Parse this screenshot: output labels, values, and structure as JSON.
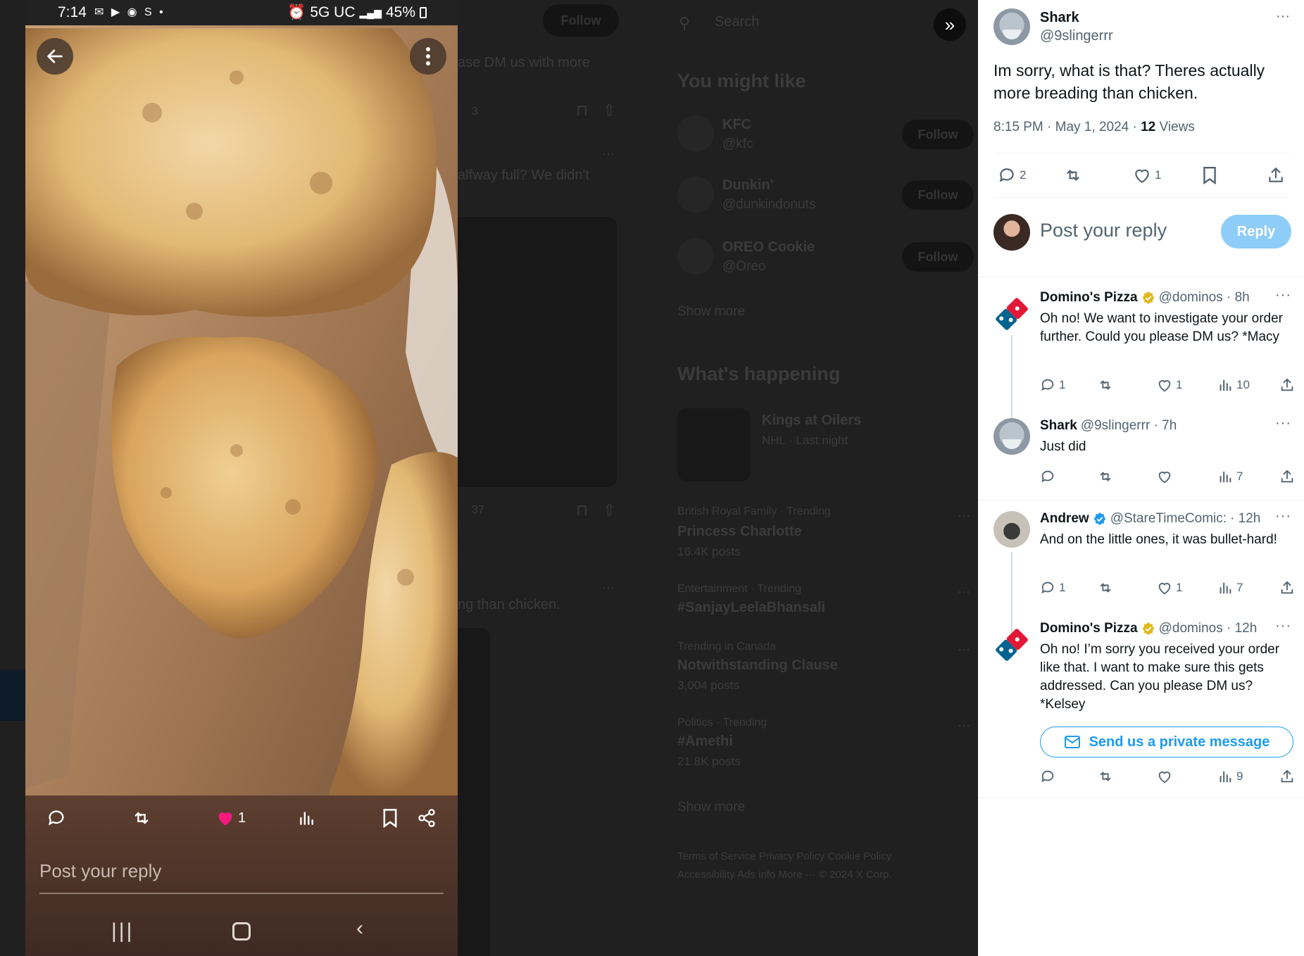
{
  "backdrop": {
    "follow_top": "Follow",
    "search_placeholder": "Search",
    "snippet_1": "ase DM us with more",
    "count_1": "3",
    "snippet_2": "alfway full? We didn't",
    "count_2": "37",
    "snippet_3": "ng than chicken.",
    "you_might_like": "You might like",
    "suggestions": [
      {
        "name": "KFC",
        "handle": "@kfc",
        "follow": "Follow"
      },
      {
        "name": "Dunkin'",
        "handle": "@dunkindonuts",
        "follow": "Follow"
      },
      {
        "name": "OREO Cookie",
        "handle": "@Oreo",
        "follow": "Follow"
      }
    ],
    "show_more_1": "Show more",
    "whats_happening": "What's happening",
    "hockey_title": "Kings at Oilers",
    "hockey_meta": "NHL · Last night",
    "trends": [
      {
        "context": "British Royal Family · Trending",
        "title": "Princess Charlotte",
        "posts": "16.4K posts"
      },
      {
        "context": "Entertainment · Trending",
        "title": "#SanjayLeelaBhansali",
        "posts": ""
      },
      {
        "context": "Trending in Canada",
        "title": "Notwithstanding Clause",
        "posts": "3,004 posts"
      },
      {
        "context": "Politics · Trending",
        "title": "#Amethi",
        "posts": "21.8K posts"
      }
    ],
    "show_more_2": "Show more",
    "footer_1": "Terms of Service   Privacy Policy   Cookie Policy",
    "footer_2": "Accessibility   Ads info   More ···   © 2024 X Corp."
  },
  "phone": {
    "time": "7:14",
    "status_icons": "✉ ▶ ◉ S •",
    "network": "5G UC",
    "signal": "▂▄▆",
    "battery": "45%",
    "like_count": "1",
    "reply_placeholder": "Post your reply",
    "colors": {
      "like": "#f91880"
    }
  },
  "main_tweet": {
    "name": "Shark",
    "handle": "@9slingerrr",
    "text": "Im sorry, what is that? Theres actually more breading than chicken.",
    "time": "8:15 PM · May 1, 2024 · ",
    "views_count": "12",
    "views_label": " Views",
    "replies": "2",
    "likes": "1"
  },
  "composer": {
    "placeholder": "Post your reply",
    "button": "Reply"
  },
  "replies": [
    {
      "name": "Domino's Pizza",
      "handle": "@dominos · 8h",
      "text": "Oh no! We want to investigate your order further. Could you please DM us? *Macy",
      "replies": "1",
      "likes": "1",
      "views": "10"
    },
    {
      "name": "Shark",
      "handle": "@9slingerrr · 7h",
      "text": "Just did",
      "replies": "",
      "likes": "",
      "views": "7"
    },
    {
      "name": "Andrew",
      "handle": "@StareTimeComic:",
      "time": "· 12h",
      "text": "And on the little ones, it was bullet-hard!",
      "replies": "1",
      "likes": "1",
      "views": "7"
    },
    {
      "name": "Domino's Pizza",
      "handle": "@dominos · 12h",
      "text": "Oh no! I’m sorry you received your order like that. I want to make sure this gets addressed. Can you please DM us? *Kelsey",
      "dm_button": "Send us a private message",
      "replies": "",
      "likes": "",
      "views": "9"
    }
  ],
  "more_glyph": "···",
  "colors": {
    "accent": "#1d9bf0",
    "reply_btn": "#8ecdf7",
    "gold_badge": "#e2b719",
    "domino_red": "#e31837",
    "domino_blue": "#006491"
  }
}
